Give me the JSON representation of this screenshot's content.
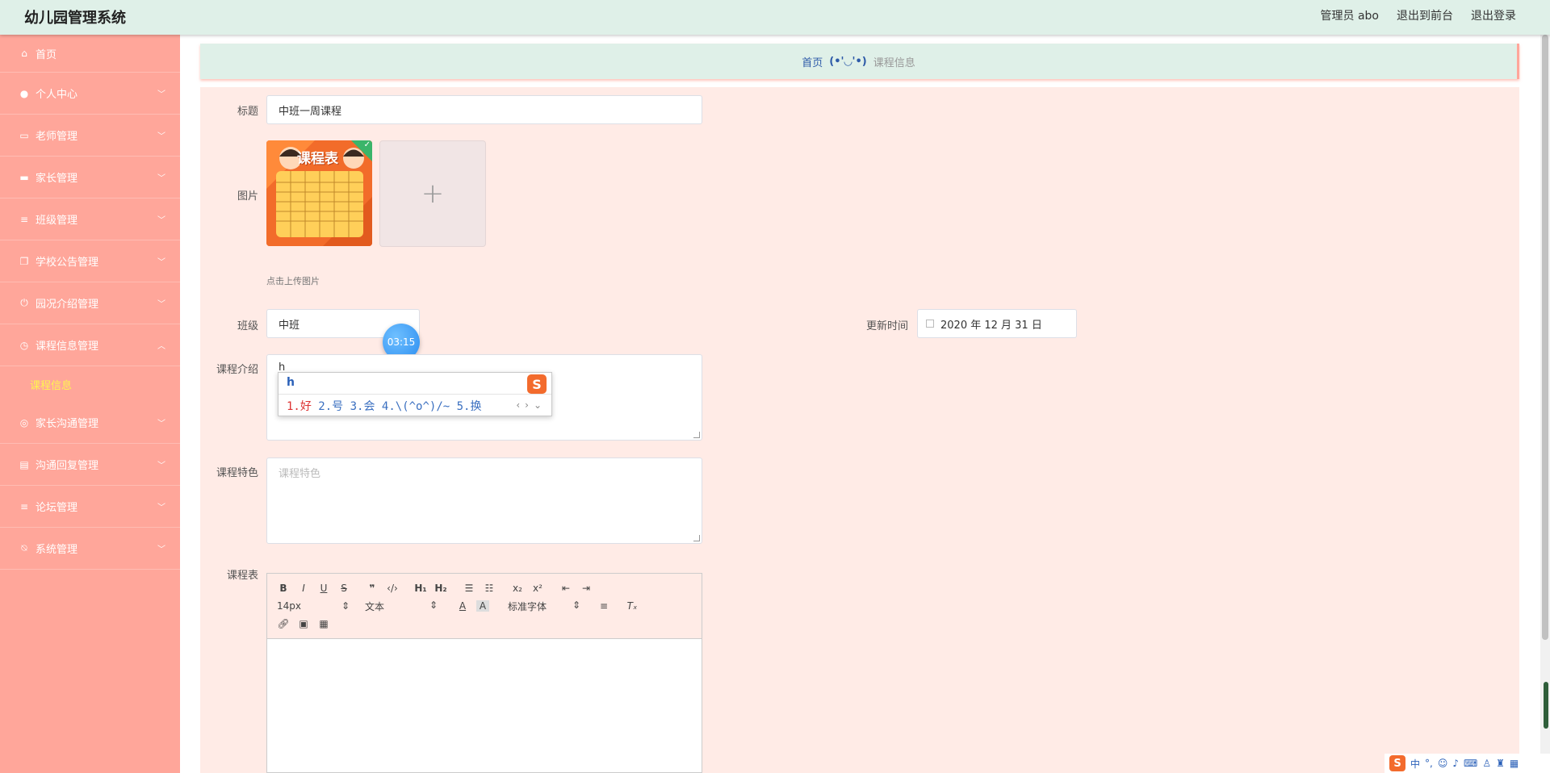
{
  "header": {
    "title": "幼儿园管理系统",
    "user": "管理员 abo",
    "front": "退出到前台",
    "logout": "退出登录"
  },
  "sidebar": {
    "items": [
      {
        "label": "首页",
        "icon": "home-icon"
      },
      {
        "label": "个人中心",
        "icon": "user-icon"
      },
      {
        "label": "老师管理",
        "icon": "chat-icon"
      },
      {
        "label": "家长管理",
        "icon": "monitor-icon"
      },
      {
        "label": "班级管理",
        "icon": "menu-icon"
      },
      {
        "label": "学校公告管理",
        "icon": "copy-icon"
      },
      {
        "label": "园况介绍管理",
        "icon": "power-icon"
      },
      {
        "label": "课程信息管理",
        "icon": "clock-icon"
      },
      {
        "label": "家长沟通管理",
        "icon": "target-icon"
      },
      {
        "label": "沟通回复管理",
        "icon": "briefcase-icon"
      },
      {
        "label": "论坛管理",
        "icon": "menu-icon"
      },
      {
        "label": "系统管理",
        "icon": "bell-off-icon"
      }
    ],
    "sub_item": "课程信息"
  },
  "breadcrumb": {
    "home": "首页",
    "sep": "(•'◡'•)",
    "current": "课程信息"
  },
  "form": {
    "title_label": "标题",
    "title_value": "中班一周课程",
    "image_label": "图片",
    "upload_tip": "点击上传图片",
    "class_label": "班级",
    "class_value": "中班",
    "update_label": "更新时间",
    "update_value": "2020 年 12 月 31 日",
    "intro_label": "课程介绍",
    "intro_value": "h",
    "feature_label": "课程特色",
    "feature_placeholder": "课程特色",
    "schedule_label": "课程表"
  },
  "thumb_text": "课程表",
  "timer": "03:15",
  "ime": {
    "composition": "h",
    "candidates": [
      "1.好",
      "2.号",
      "3.会",
      "4.\\(^o^)/~",
      "5.换"
    ]
  },
  "editor": {
    "size": "14px",
    "header": "文本",
    "font": "标准字体"
  },
  "tray": {
    "lang": "中",
    "punct": "°,"
  }
}
